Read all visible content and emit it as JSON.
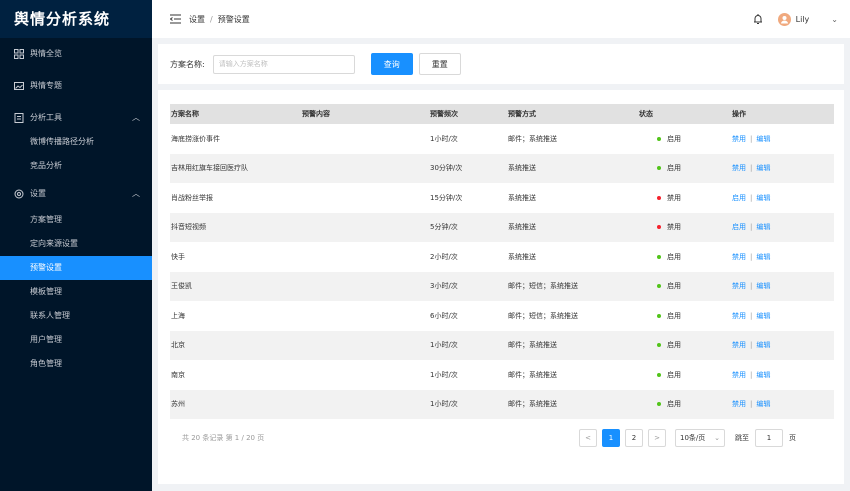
{
  "app": {
    "title": "舆情分析系统"
  },
  "sidebar": {
    "items": [
      {
        "label": "舆情全览",
        "icon": "dashboard-icon"
      },
      {
        "label": "舆情专题",
        "icon": "image-icon"
      },
      {
        "label": "分析工具",
        "icon": "file-icon",
        "arrow": "︿"
      },
      {
        "label": "设置",
        "icon": "gear-icon",
        "arrow": "︿"
      }
    ],
    "analysis_sub": [
      "微博传播路径分析",
      "竞品分析"
    ],
    "settings_sub": [
      "方案管理",
      "定向来源设置",
      "预警设置",
      "模板管理",
      "联系人管理",
      "用户管理",
      "角色管理"
    ]
  },
  "header": {
    "breadcrumb": [
      "设置",
      "预警设置"
    ],
    "breadcrumb_sep": "/",
    "user": "Lily",
    "chevron": "⌄"
  },
  "filter": {
    "label": "方案名称:",
    "placeholder": "请输入方案名称",
    "search_label": "查询",
    "reset_label": "重置"
  },
  "table": {
    "columns": [
      "方案名称",
      "预警内容",
      "预警频次",
      "预警方式",
      "状态",
      "操作"
    ],
    "rows": [
      {
        "name": "海底捞涨价事件",
        "content": "",
        "freq": "1小时/次",
        "method": "邮件；系统推送",
        "status": "启用",
        "status_color": "#52c41a",
        "toggle": "禁用",
        "edit": "编辑"
      },
      {
        "name": "吉林用红旗车接回医疗队",
        "content": "",
        "freq": "30分钟/次",
        "method": "系统推送",
        "status": "启用",
        "status_color": "#52c41a",
        "toggle": "禁用",
        "edit": "编辑"
      },
      {
        "name": "肖战粉丝举报",
        "content": "",
        "freq": "15分钟/次",
        "method": "系统推送",
        "status": "禁用",
        "status_color": "#f5222d",
        "toggle": "启用",
        "edit": "编辑"
      },
      {
        "name": "抖音短视频",
        "content": "",
        "freq": "5分钟/次",
        "method": "系统推送",
        "status": "禁用",
        "status_color": "#f5222d",
        "toggle": "启用",
        "edit": "编辑"
      },
      {
        "name": "快手",
        "content": "",
        "freq": "2小时/次",
        "method": "系统推送",
        "status": "启用",
        "status_color": "#52c41a",
        "toggle": "禁用",
        "edit": "编辑"
      },
      {
        "name": "王俊凯",
        "content": "",
        "freq": "3小时/次",
        "method": "邮件；短信；系统推送",
        "status": "启用",
        "status_color": "#52c41a",
        "toggle": "禁用",
        "edit": "编辑"
      },
      {
        "name": "上海",
        "content": "",
        "freq": "6小时/次",
        "method": "邮件；短信；系统推送",
        "status": "启用",
        "status_color": "#52c41a",
        "toggle": "禁用",
        "edit": "编辑"
      },
      {
        "name": "北京",
        "content": "",
        "freq": "1小时/次",
        "method": "邮件；系统推送",
        "status": "启用",
        "status_color": "#52c41a",
        "toggle": "禁用",
        "edit": "编辑"
      },
      {
        "name": "南京",
        "content": "",
        "freq": "1小时/次",
        "method": "邮件；系统推送",
        "status": "启用",
        "status_color": "#52c41a",
        "toggle": "禁用",
        "edit": "编辑"
      },
      {
        "name": "苏州",
        "content": "",
        "freq": "1小时/次",
        "method": "邮件；系统推送",
        "status": "启用",
        "status_color": "#52c41a",
        "toggle": "禁用",
        "edit": "编辑"
      }
    ]
  },
  "pagination": {
    "total": "共 20 条记录 第 1 / 20 页",
    "prev": "<",
    "next": ">",
    "pages": [
      "1",
      "2"
    ],
    "page_size": "10条/页",
    "page_size_arrow": "⌄",
    "jump_label": "跳至",
    "jump_value": "1",
    "jump_suffix": "页"
  },
  "colors": {
    "sidebar_bg": "#001529",
    "accent": "#1890ff",
    "enabled": "#52c41a",
    "disabled": "#f5222d"
  }
}
